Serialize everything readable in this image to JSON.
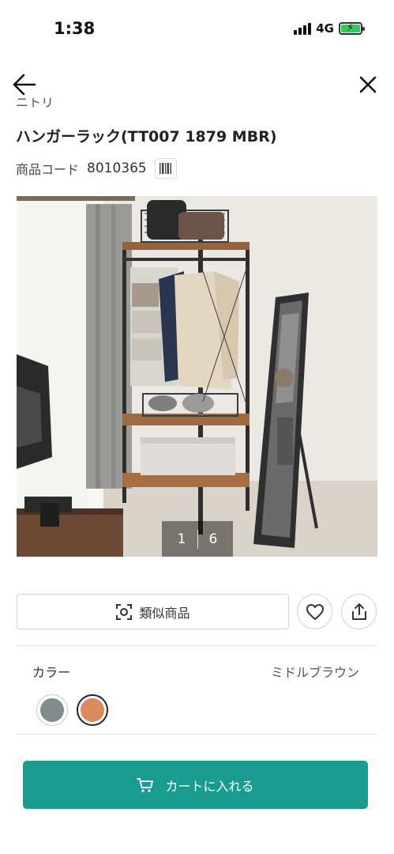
{
  "status_bar": {
    "time": "1:38",
    "network": "4G"
  },
  "nav": {
    "back_icon": "arrow-left-icon",
    "close_icon": "close-icon"
  },
  "product": {
    "title": "ハンガーラック(TT007 1879 MBR)",
    "code_label": "商品コード",
    "code_value": "8010365",
    "barcode_icon": "barcode-icon"
  },
  "gallery": {
    "current": "1",
    "total": "6"
  },
  "actions": {
    "similar_label": "類似商品",
    "similar_icon": "visual-search-icon",
    "favorite_icon": "heart-icon",
    "share_icon": "share-icon"
  },
  "color": {
    "label": "カラー",
    "selected_name": "ミドルブラウン",
    "swatches": [
      {
        "name": "gray",
        "hex": "#7f8c8d"
      },
      {
        "name": "middle-brown",
        "hex": "#d98b5f"
      }
    ]
  },
  "cart": {
    "label": "カートに入れる",
    "icon": "cart-icon",
    "color": "#1a9b8f"
  }
}
